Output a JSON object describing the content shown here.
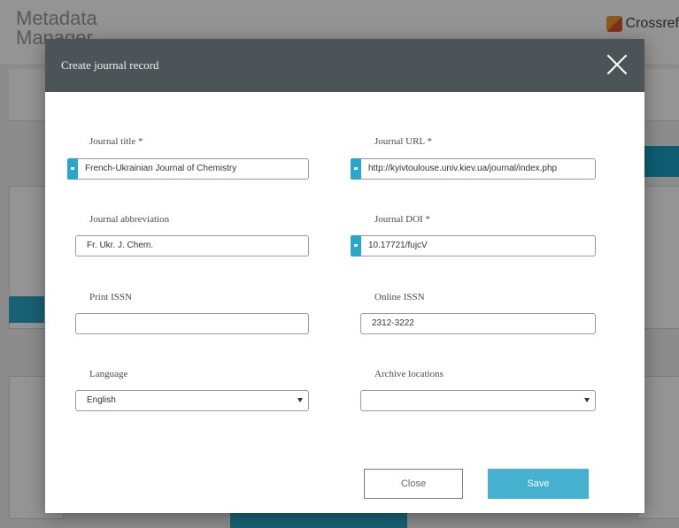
{
  "background": {
    "app_title": "Metadata Manager",
    "brand_name": "Crossref"
  },
  "modal": {
    "title": "Create journal record",
    "fields": {
      "journal_title": {
        "label": "Journal title *",
        "value": "French-Ukrainian Journal of Chemistry"
      },
      "journal_url": {
        "label": "Journal URL *",
        "value": "http://kyivtoulouse.univ.kiev.ua/journal/index.php"
      },
      "journal_abbreviation": {
        "label": "Journal abbreviation",
        "value": "Fr. Ukr. J. Chem."
      },
      "journal_doi": {
        "label": "Journal DOI *",
        "value": "10.17721/fujcV"
      },
      "print_issn": {
        "label": "Print ISSN",
        "value": ""
      },
      "online_issn": {
        "label": "Online ISSN",
        "value": "2312-3222"
      },
      "language": {
        "label": "Language",
        "value": "English"
      },
      "archive_locations": {
        "label": "Archive locations",
        "value": ""
      }
    },
    "buttons": {
      "close": "Close",
      "save": "Save"
    }
  },
  "colors": {
    "header": "#4c5458",
    "accent": "#46b1cf",
    "tag": "#2aa7c8"
  },
  "icons": {
    "close": "close-icon",
    "dropdown": "chevron-down-icon"
  }
}
